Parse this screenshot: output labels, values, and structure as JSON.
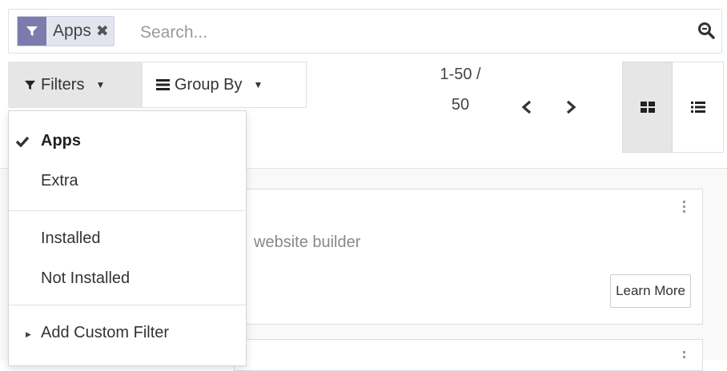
{
  "search": {
    "facet_label": "Apps",
    "placeholder": "Search..."
  },
  "controls": {
    "filters_label": "Filters",
    "groupby_label": "Group By"
  },
  "pager": {
    "value": "1-50 /",
    "limit": "50"
  },
  "filters_menu": {
    "items": [
      {
        "label": "Apps",
        "selected": true
      },
      {
        "label": "Extra",
        "selected": false
      }
    ],
    "installed_items": [
      {
        "label": "Installed"
      },
      {
        "label": "Not Installed"
      }
    ],
    "add_custom_label": "Add Custom Filter"
  },
  "cards": [
    {
      "description": "website builder",
      "button_label": "Learn More"
    }
  ],
  "colors": {
    "facet_accent": "#7c7bad",
    "active_button_bg": "#e6e6e6"
  },
  "icons": {
    "facet": "filter-icon",
    "facet_remove": "close-icon",
    "search": "search-icon",
    "filters": "filter-icon",
    "groupby": "list-lines-icon",
    "pager_prev": "chevron-left-icon",
    "pager_next": "chevron-right-icon",
    "kanban": "kanban-grid-icon",
    "list": "list-view-icon"
  }
}
